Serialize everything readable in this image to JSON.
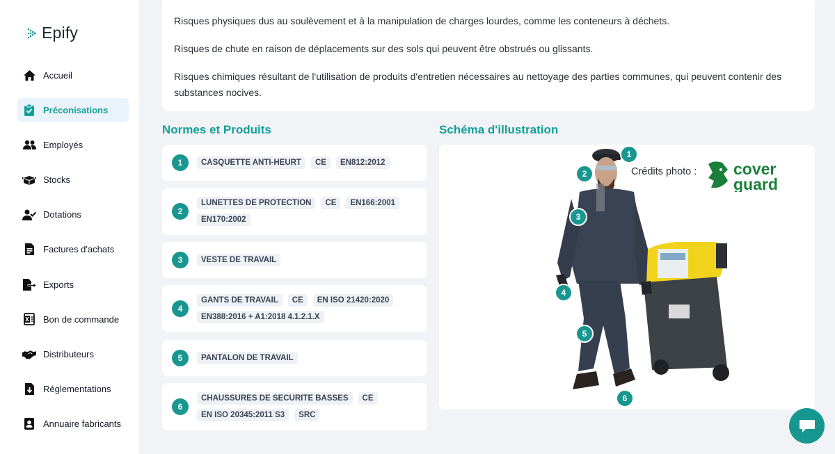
{
  "app": {
    "name": "Epify"
  },
  "sidebar": {
    "items": [
      {
        "label": "Accueil",
        "icon": "home-icon"
      },
      {
        "label": "Préconisations",
        "icon": "clipboard-check-icon",
        "active": true
      },
      {
        "label": "Employés",
        "icon": "users-icon"
      },
      {
        "label": "Stocks",
        "icon": "boxes-icon"
      },
      {
        "label": "Dotations",
        "icon": "user-check-icon"
      },
      {
        "label": "Factures d'achats",
        "icon": "invoice-icon"
      },
      {
        "label": "Exports",
        "icon": "file-export-icon"
      },
      {
        "label": "Bon de commande",
        "icon": "excel-file-icon"
      },
      {
        "label": "Distributeurs",
        "icon": "handshake-icon"
      },
      {
        "label": "Réglementations",
        "icon": "file-download-icon"
      },
      {
        "label": "Annuaire fabricants",
        "icon": "contact-card-icon"
      }
    ]
  },
  "risks": [
    "Risques physiques dus au soulèvement et à la manipulation de charges lourdes, comme les conteneurs à déchets.",
    "Risques de chute en raison de déplacements sur des sols qui peuvent être obstrués ou glissants.",
    "Risques chimiques résultant de l'utilisation de produits d'entretien nécessaires au nettoyage des parties communes, qui peuvent contenir des substances nocives."
  ],
  "norms": {
    "title": "Normes et Produits",
    "items": [
      {
        "num": "1",
        "tags": [
          "CASQUETTE ANTI-HEURT",
          "CE",
          "EN812:2012"
        ]
      },
      {
        "num": "2",
        "tags": [
          "LUNETTES DE PROTECTION",
          "CE",
          "EN166:2001",
          "EN170:2002"
        ]
      },
      {
        "num": "3",
        "tags": [
          "VESTE DE TRAVAIL"
        ]
      },
      {
        "num": "4",
        "tags": [
          "GANTS DE TRAVAIL",
          "CE",
          "EN ISO 21420:2020",
          "EN388:2016 + A1:2018 4.1.2.1.X"
        ]
      },
      {
        "num": "5",
        "tags": [
          "PANTALON DE TRAVAIL"
        ]
      },
      {
        "num": "6",
        "tags": [
          "CHAUSSURES DE SECURITE BASSES",
          "CE",
          "EN ISO 20345:2011 S3",
          "SRC"
        ]
      }
    ]
  },
  "illustration": {
    "title": "Schéma d'illustration",
    "credit_label": "Crédits photo :",
    "brand_line1": "cover",
    "brand_line2": "guard",
    "markers": [
      "1",
      "2",
      "3",
      "4",
      "5",
      "6"
    ]
  },
  "colors": {
    "accent": "#17978f",
    "accent_text": "#14a098",
    "bin_yellow": "#f2d31c",
    "brand_green": "#1a7f3c"
  },
  "chat": {
    "icon": "chat-bubble-icon"
  }
}
